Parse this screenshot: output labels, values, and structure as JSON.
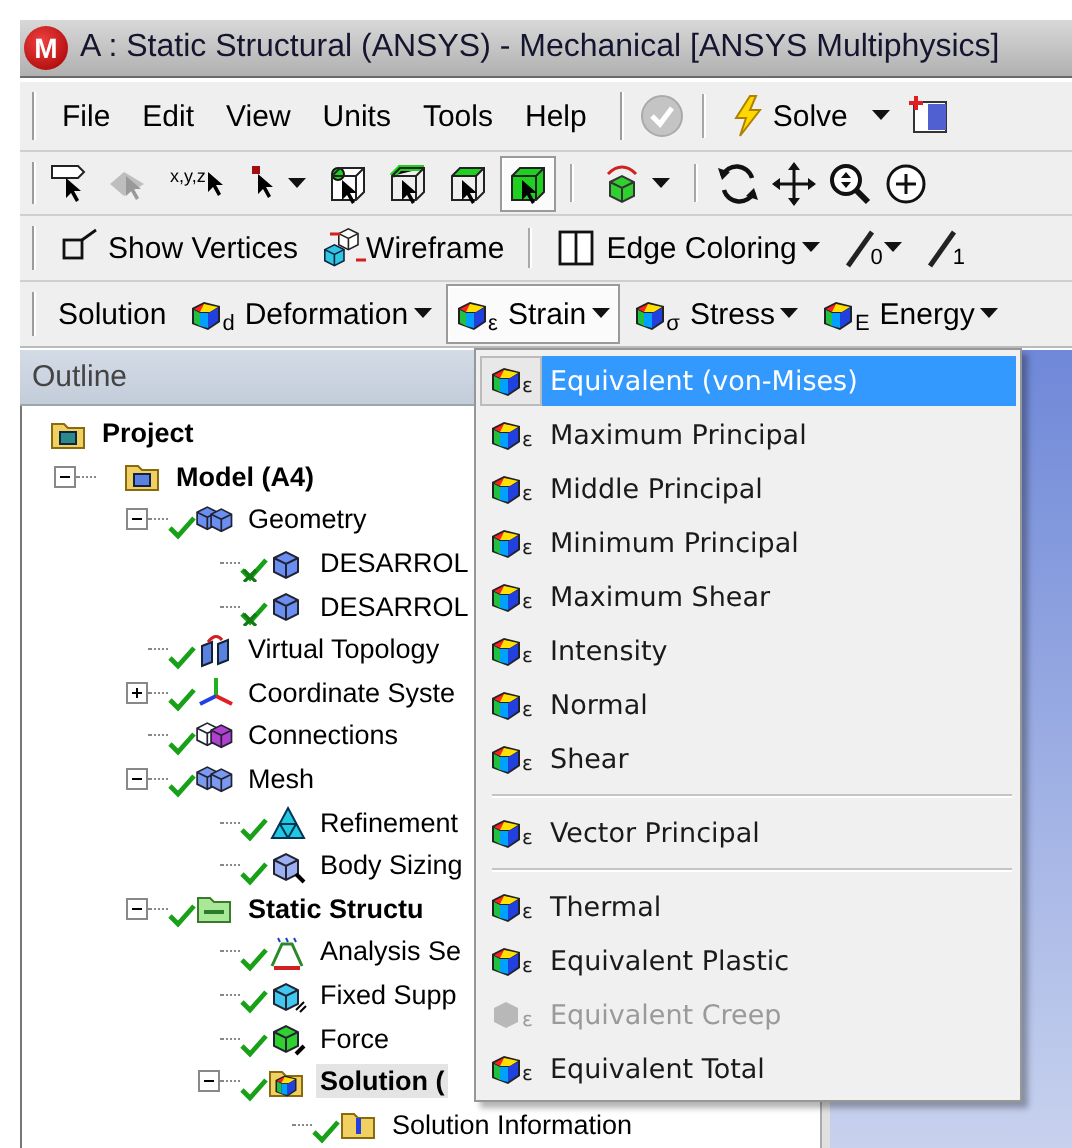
{
  "window": {
    "logo": "M",
    "title": "A : Static Structural (ANSYS) - Mechanical [ANSYS Multiphysics]"
  },
  "menu_bar": [
    "File",
    "Edit",
    "View",
    "Units",
    "Tools",
    "Help"
  ],
  "solve_button": {
    "label": "Solve",
    "dropdown": true
  },
  "graphics_toolbar": {
    "coordinates_symbol": "x,y,z",
    "selection_modes": [
      {
        "kind": "vertex",
        "selected": false
      },
      {
        "kind": "edge",
        "selected": false
      },
      {
        "kind": "face",
        "selected": false
      },
      {
        "kind": "body",
        "selected": true
      }
    ]
  },
  "view_toolbar": {
    "buttons": [
      {
        "kind": "vertices",
        "label": "Show Vertices",
        "dropdown": false
      },
      {
        "kind": "wireframe",
        "label": "Wireframe",
        "dropdown": false
      },
      {
        "kind": "edge-coloring",
        "label": "Edge Coloring",
        "dropdown": true
      }
    ],
    "edge_tools": [
      {
        "symbol": "0",
        "dropdown": true
      },
      {
        "symbol": "1",
        "dropdown": false
      }
    ]
  },
  "solution_toolbar": [
    {
      "label": "Solution",
      "dropdown": false,
      "selected": false
    },
    {
      "label": "Deformation",
      "symbol": "d",
      "dropdown": true,
      "selected": false
    },
    {
      "label": "Strain",
      "symbol": "ε",
      "dropdown": true,
      "selected": true
    },
    {
      "label": "Stress",
      "symbol": "σ",
      "dropdown": true,
      "selected": false
    },
    {
      "label": "Energy",
      "symbol": "E",
      "dropdown": true,
      "selected": false
    }
  ],
  "outline": {
    "title": "Outline",
    "tree": [
      {
        "label": "Project",
        "kind": "project",
        "bold": true,
        "checked": false,
        "selected": false,
        "children": [
          {
            "label": "Model (A4)",
            "kind": "model",
            "bold": true,
            "checked": false,
            "selected": false,
            "expanded": true,
            "children": [
              {
                "label": "Geometry",
                "kind": "geometry",
                "checked": true,
                "selected": false,
                "expanded": true,
                "children": [
                  {
                    "label": "DESARROL",
                    "kind": "part",
                    "checked": true,
                    "crossed": true,
                    "selected": false
                  },
                  {
                    "label": "DESARROL",
                    "kind": "part",
                    "checked": true,
                    "crossed": true,
                    "selected": false
                  }
                ]
              },
              {
                "label": "Virtual Topology",
                "kind": "topology",
                "checked": true,
                "selected": false
              },
              {
                "label": "Coordinate Syste",
                "kind": "coords",
                "checked": true,
                "selected": false,
                "expanded": false
              },
              {
                "label": "Connections",
                "kind": "connections",
                "checked": true,
                "selected": false
              },
              {
                "label": "Mesh",
                "kind": "mesh",
                "checked": true,
                "selected": false,
                "expanded": true,
                "children": [
                  {
                    "label": "Refinement",
                    "kind": "refinement",
                    "checked": true,
                    "selected": false
                  },
                  {
                    "label": "Body Sizing",
                    "kind": "sizing",
                    "checked": true,
                    "selected": false
                  }
                ]
              },
              {
                "label": "Static Structu",
                "kind": "analysis",
                "bold": true,
                "checked": true,
                "selected": false,
                "expanded": true,
                "children": [
                  {
                    "label": "Analysis Se",
                    "kind": "settings",
                    "checked": true,
                    "selected": false
                  },
                  {
                    "label": "Fixed Supp",
                    "kind": "support",
                    "checked": true,
                    "selected": false
                  },
                  {
                    "label": "Force",
                    "kind": "force",
                    "checked": true,
                    "selected": false
                  },
                  {
                    "label": "Solution (",
                    "kind": "solution",
                    "bold": true,
                    "checked": true,
                    "selected": true,
                    "expanded": true,
                    "children": [
                      {
                        "label": "Solution Information",
                        "kind": "info",
                        "checked": true,
                        "selected": false
                      }
                    ]
                  }
                ]
              }
            ]
          }
        ]
      }
    ]
  },
  "strain_menu": {
    "groups": [
      [
        {
          "label": "Equivalent (von-Mises)",
          "symbol": "ε",
          "selected": true,
          "disabled": false
        },
        {
          "label": "Maximum Principal",
          "symbol": "ε",
          "selected": false,
          "disabled": false
        },
        {
          "label": "Middle Principal",
          "symbol": "ε",
          "selected": false,
          "disabled": false
        },
        {
          "label": "Minimum Principal",
          "symbol": "ε",
          "selected": false,
          "disabled": false
        },
        {
          "label": "Maximum Shear",
          "symbol": "ε",
          "selected": false,
          "disabled": false
        },
        {
          "label": "Intensity",
          "symbol": "ε",
          "selected": false,
          "disabled": false
        },
        {
          "label": "Normal",
          "symbol": "ε",
          "selected": false,
          "disabled": false
        },
        {
          "label": "Shear",
          "symbol": "ε",
          "selected": false,
          "disabled": false
        }
      ],
      [
        {
          "label": "Vector Principal",
          "symbol": "ε",
          "selected": false,
          "disabled": false
        }
      ],
      [
        {
          "label": "Thermal",
          "symbol": "ε",
          "selected": false,
          "disabled": false
        },
        {
          "label": "Equivalent Plastic",
          "symbol": "ε",
          "selected": false,
          "disabled": false
        },
        {
          "label": "Equivalent Creep",
          "symbol": "ε",
          "selected": false,
          "disabled": true
        },
        {
          "label": "Equivalent Total",
          "symbol": "ε",
          "selected": false,
          "disabled": false
        }
      ]
    ]
  }
}
